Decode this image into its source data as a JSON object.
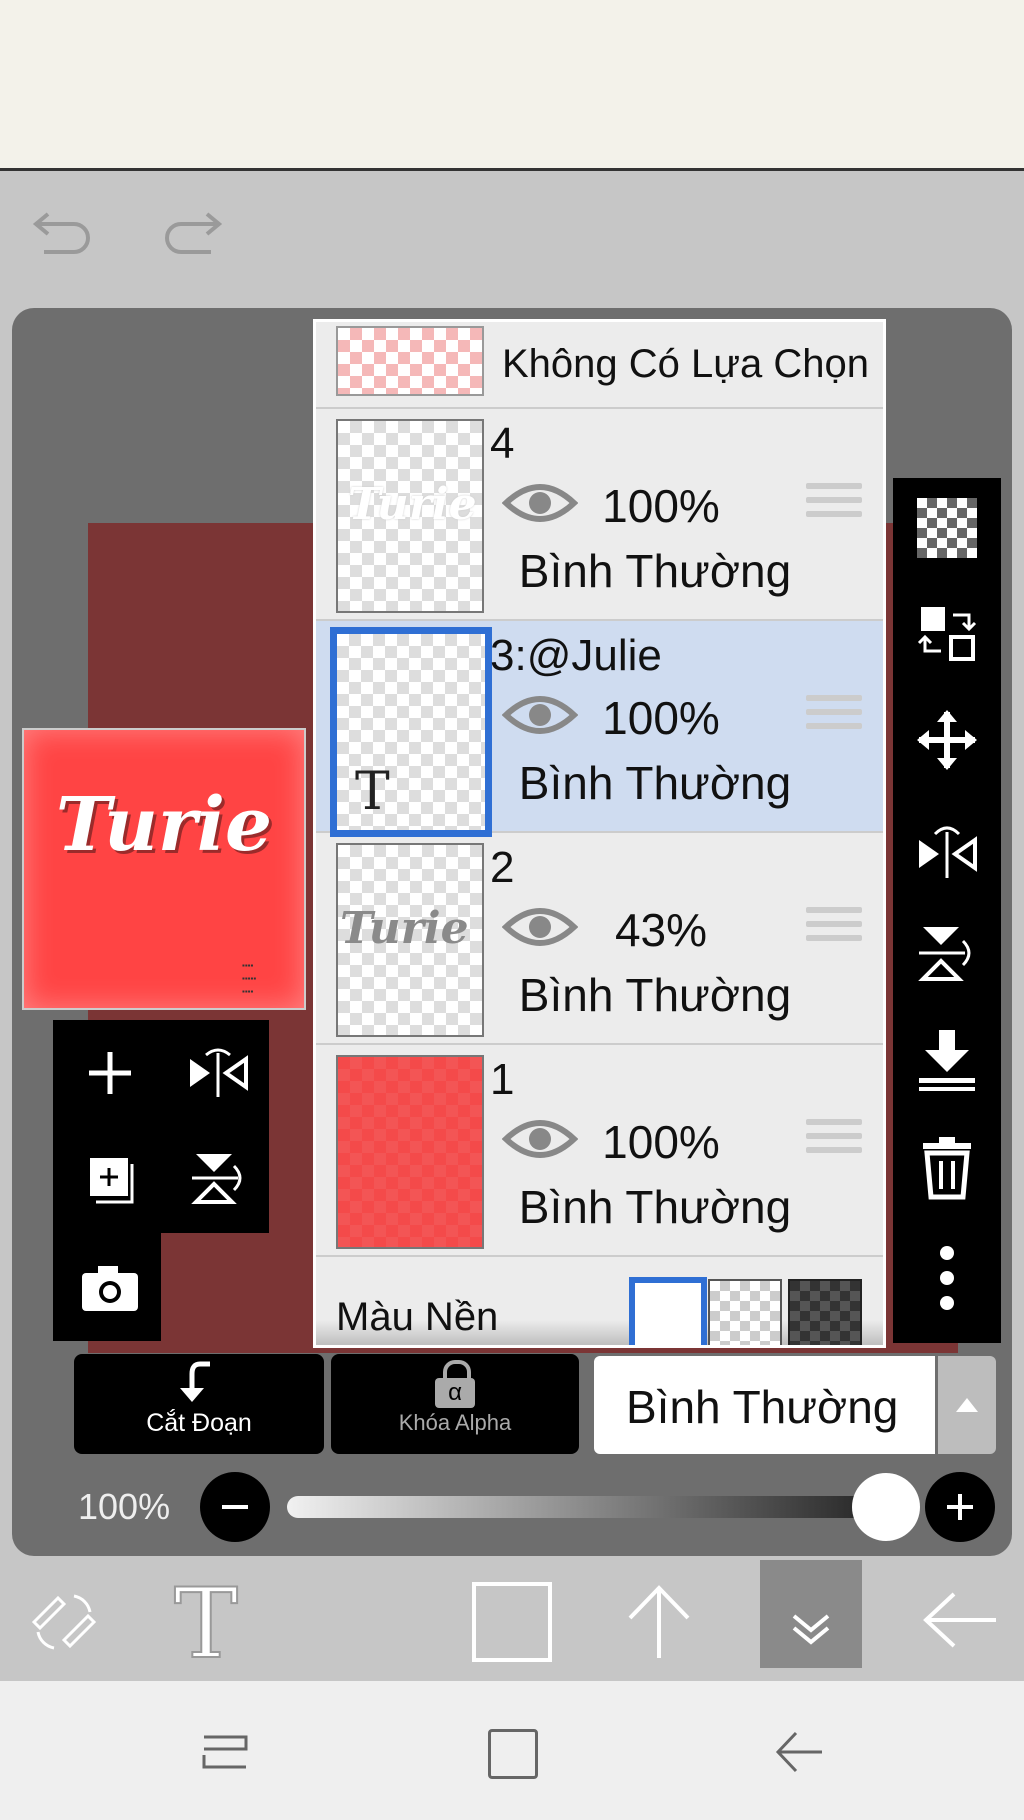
{
  "layers_panel": {
    "no_selection_label": "Không Có Lựa Chọn",
    "layers": [
      {
        "name": "4",
        "opacity": "100%",
        "blend": "Bình Thường",
        "selected": false
      },
      {
        "name": "3:@Julie",
        "opacity": "100%",
        "blend": "Bình Thường",
        "selected": true
      },
      {
        "name": "2",
        "opacity": "43%",
        "blend": "Bình Thường",
        "selected": false
      },
      {
        "name": "1",
        "opacity": "100%",
        "blend": "Bình Thường",
        "selected": false
      }
    ],
    "background_label": "Màu Nền"
  },
  "preview": {
    "title": "Turie"
  },
  "text_layer_glyph": "T",
  "actions": {
    "cut_label": "Cắt Đoạn",
    "alpha_lock_label": "Khóa Alpha",
    "alpha_glyph": "α"
  },
  "blend_mode": {
    "current": "Bình Thường"
  },
  "opacity_slider": {
    "label": "100%",
    "value": 1.0
  },
  "colors": {
    "selected_row": "#cfdcf0",
    "selection_border": "#2f6fd4",
    "layer1_fill": "#f44a4a",
    "accent_black": "#000000"
  },
  "icons": [
    "undo-icon",
    "redo-icon",
    "add-layer-icon",
    "flip-horizontal-icon",
    "duplicate-layer-icon",
    "flip-vertical-icon",
    "camera-icon",
    "transparency-icon",
    "swap-icon",
    "move-icon",
    "merge-down-icon",
    "trash-icon",
    "more-icon",
    "eye-icon",
    "drag-handle-icon",
    "transform-icon",
    "text-tool-icon",
    "rectangle-icon",
    "up-arrow-icon",
    "collapse-icon",
    "back-icon"
  ]
}
